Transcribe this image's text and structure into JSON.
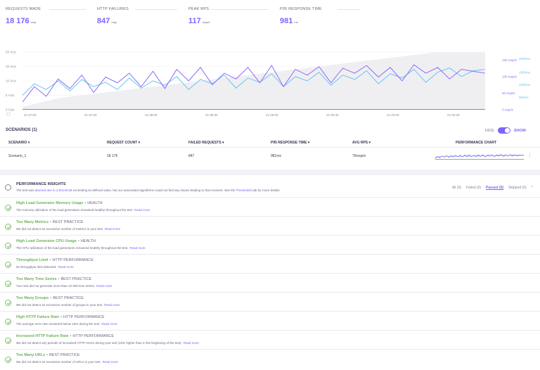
{
  "metrics": [
    {
      "label": "REQUESTS MADE",
      "value": "18 176",
      "unit": "reqs"
    },
    {
      "label": "HTTP FAILURES",
      "value": "847",
      "unit": "reqs"
    },
    {
      "label": "PEAK RPS",
      "value": "117",
      "unit": "reqs/s"
    },
    {
      "label": "P95 RESPONSE TIME",
      "value": "981",
      "unit": "ms"
    }
  ],
  "colors": {
    "accent": "#7d64ff",
    "vus": "#d9d9de",
    "rps": "#8f6df5",
    "resp": "#6cc3f0",
    "fail": "#ef4b6b",
    "pass": "#6cb35a"
  },
  "chart_data": {
    "type": "line",
    "x": [
      "21:37:00",
      "21:37:30",
      "21:38:00",
      "21:38:30",
      "21:39:00",
      "21:39:30",
      "21:40:00",
      "21:40:30"
    ],
    "y_left_ticks": [
      "0 VUs",
      "5 VUs",
      "10 VUs",
      "15 VUs",
      "20 VUs"
    ],
    "y_right_rps_ticks": [
      "0 reqs/s",
      "50 reqs/s",
      "100 reqs/s",
      "150 reqs/s"
    ],
    "y_right_ms_ticks": [
      "500ms",
      "1000ms",
      "1500ms",
      "2000ms"
    ],
    "ylim_vus": [
      0,
      20
    ],
    "ylim_rps": [
      0,
      150
    ],
    "ylim_ms": [
      0,
      2000
    ],
    "series": [
      {
        "key": "vus",
        "values": [
          1,
          2,
          3,
          4,
          4.5,
          5,
          5.5,
          6,
          6.5,
          7,
          7.5,
          8,
          8.5,
          9,
          9.5,
          10,
          10.5,
          11,
          11.5,
          12,
          12.5,
          13,
          13.5,
          14,
          14.5,
          15,
          15.5,
          16,
          16.5,
          17,
          17.5,
          18,
          18.5,
          19,
          19.5,
          20,
          20,
          20,
          20,
          20
        ]
      },
      {
        "key": "rps",
        "values": [
          20,
          60,
          35,
          80,
          55,
          90,
          45,
          85,
          70,
          95,
          60,
          100,
          55,
          105,
          75,
          110,
          65,
          95,
          80,
          110,
          70,
          115,
          60,
          105,
          90,
          112,
          70,
          108,
          95,
          115,
          85,
          110,
          75,
          117,
          95,
          110,
          80,
          105,
          100,
          95
        ]
      },
      {
        "key": "resp",
        "values": [
          500,
          900,
          700,
          1000,
          650,
          1050,
          800,
          950,
          700,
          1100,
          750,
          1000,
          850,
          1150,
          700,
          1050,
          900,
          1200,
          750,
          1100,
          950,
          1250,
          800,
          1150,
          1000,
          1300,
          850,
          1200,
          1050,
          1350,
          900,
          1250,
          1100,
          1400,
          950,
          1300,
          1450,
          1150,
          1350,
          1400
        ]
      },
      {
        "key": "fail",
        "values": [
          1,
          1,
          1,
          1,
          1,
          1,
          1,
          1,
          1,
          1,
          1,
          1,
          1,
          1,
          1,
          1,
          1,
          1,
          1,
          1,
          1,
          1,
          1,
          1,
          1,
          1,
          1,
          1,
          1,
          1,
          1,
          1,
          1,
          1,
          1,
          1,
          1,
          1,
          1,
          1
        ]
      }
    ]
  },
  "scenarios": {
    "title": "SCENARIOS (1)",
    "hide_label": "HIDE",
    "show_label": "SHOW",
    "columns": [
      "SCENARIO ▾",
      "REQUEST COUNT ▾",
      "FAILED REQUESTS ▾",
      "P95 RESPONSE TIME ▾",
      "AVG RPS ▾",
      "PERFORMANCE CHART"
    ],
    "row": [
      "Scenario_1",
      "18 176",
      "847",
      "981ms",
      "76reqs/s"
    ]
  },
  "insights_header": {
    "title": "PERFORMANCE INSIGHTS",
    "desc_pre": "The test was ",
    "desc_link": "aborted due to a threshold",
    "desc_mid": " exceeding its defined value, but our automated algorithms could not find any issues leading to that moment. See the ",
    "desc_link2": "Thresholds",
    "desc_post": " tab for more details.",
    "filters": [
      "All (9)",
      "Failed (0)",
      "Passed (9)",
      "Skipped (0)"
    ],
    "chevron": "^"
  },
  "insights": [
    {
      "name": "High Load Generator Memory Usage",
      "category": "HEALTH",
      "desc": "The memory utilization of the load generators remained healthy throughout the test.",
      "more": "Read more"
    },
    {
      "name": "Too Many Metrics",
      "category": "BEST PRACTICE",
      "desc": "We did not detect an excessive number of metrics in your test.",
      "more": "Read more"
    },
    {
      "name": "High Load Generator CPU Usage",
      "category": "HEALTH",
      "desc": "The CPU utilization of the load generators remained healthy throughout the test.",
      "more": "Read more"
    },
    {
      "name": "Throughput Limit",
      "category": "HTTP PERFORMANCE",
      "desc": "No throughput limit detected.",
      "more": "Read more"
    },
    {
      "name": "Too Many Time Series",
      "category": "BEST PRACTICE",
      "desc": "Your test did not generate more than 10 000 time series.",
      "more": "Read more"
    },
    {
      "name": "Too Many Groups",
      "category": "BEST PRACTICE",
      "desc": "We did not detect an excessive number of groups in your test.",
      "more": "Read more"
    },
    {
      "name": "High HTTP Failure Rate",
      "category": "HTTP PERFORMANCE",
      "desc": "The average error rate remained below 15% during the test.",
      "more": "Read more"
    },
    {
      "name": "Increased HTTP Failure Rate",
      "category": "HTTP PERFORMANCE",
      "desc": "We did not detect any periods of increased HTTP errors during your test (10% higher than in the beginning of the test).",
      "more": "Read more"
    },
    {
      "name": "Too Many URLs",
      "category": "BEST PRACTICE",
      "desc": "We did not detect an excessive number of URLs in your test.",
      "more": "Read more"
    }
  ]
}
